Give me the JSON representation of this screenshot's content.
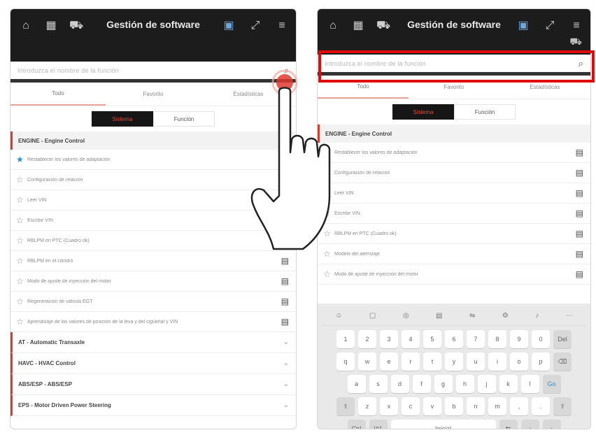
{
  "app": {
    "title": "Gestión de software",
    "search_placeholder": "Introduzca el nombre de la función"
  },
  "tabs": [
    "Todo",
    "Favorito",
    "Estadísticas"
  ],
  "segment": {
    "on": "Sistema",
    "off": "Función"
  },
  "section": {
    "title": "ENGINE - Engine Control"
  },
  "left_rows": [
    {
      "label": "Restablecer los valores de adaptación",
      "favorite": true
    },
    {
      "label": "Configuración de relación",
      "favorite": false
    },
    {
      "label": "Leer VIN",
      "favorite": false
    },
    {
      "label": "Escribir VIN",
      "favorite": false
    },
    {
      "label": "RBLPM en PTC (Cuadro ok)",
      "favorite": false
    },
    {
      "label": "RBLPM en el cilindro",
      "favorite": false
    },
    {
      "label": "Modo de ajuste de inyección del motor",
      "favorite": false
    },
    {
      "label": "Regeneración de válvula EGT",
      "favorite": false
    },
    {
      "label": "Aprendizaje de los valores de posición de la leva y del cigüeñal y VIN",
      "favorite": false
    }
  ],
  "groups": [
    "AT - Automatic Transaxle",
    "HAVC - HVAC Control",
    "ABS/ESP - ABS/ESP",
    "EPS - Motor Driven Power Steering"
  ],
  "right_rows": [
    {
      "label": "Restablecer los valores de adaptación",
      "favorite": true
    },
    {
      "label": "Configuración de relación",
      "favorite": false
    },
    {
      "label": "Leer VIN",
      "favorite": false
    },
    {
      "label": "Escribir VIN",
      "favorite": false
    },
    {
      "label": "RBLPM en PTC (Cuadro ok)",
      "favorite": false
    },
    {
      "label": "Modelo del aterrizaje",
      "favorite": false
    },
    {
      "label": "Modo de ajuste de inyección del motor",
      "favorite": false
    }
  ],
  "keyboard": {
    "row1": [
      "1",
      "2",
      "3",
      "4",
      "5",
      "6",
      "7",
      "8",
      "9",
      "0",
      "Del"
    ],
    "row2": [
      "q",
      "w",
      "e",
      "r",
      "t",
      "y",
      "u",
      "i",
      "o",
      "p",
      "⌫"
    ],
    "row3": [
      "a",
      "s",
      "d",
      "f",
      "g",
      "h",
      "j",
      "k",
      "l",
      "Go"
    ],
    "row4": [
      "⇧",
      "z",
      "x",
      "c",
      "v",
      "b",
      "n",
      "m",
      ",",
      ".",
      "⇧"
    ],
    "row5": [
      "Ctrl",
      "!#1",
      "Inicial",
      "⇆",
      "‹",
      "›"
    ]
  },
  "colors": {
    "accent": "#d63c2f",
    "highlight": "#e10b0b",
    "favorite": "#2f8fd6"
  },
  "icons": {
    "topbar_left": [
      "home-icon",
      "car-icon",
      "vehicle-info-icon"
    ],
    "topbar_right": [
      "language-icon",
      "fullscreen-icon",
      "menu-icon"
    ]
  }
}
